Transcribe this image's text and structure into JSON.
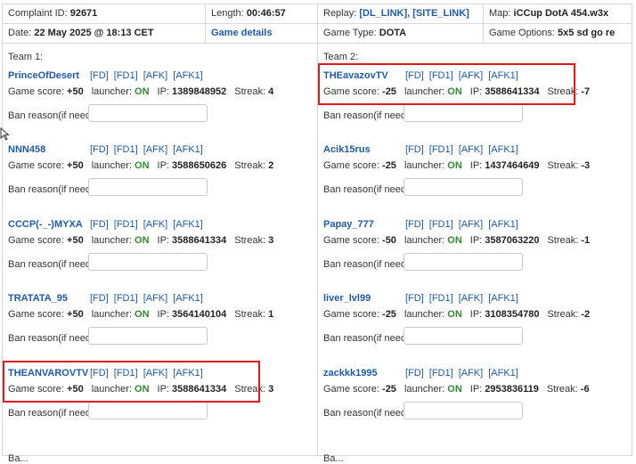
{
  "header": {
    "complaint_label": "Complaint ID: ",
    "complaint_id": "92671",
    "length_label": "Length: ",
    "length_value": "00:46:57",
    "replay_label": "Replay: ",
    "replay_links": "[DL_LINK], [SITE_LINK]",
    "map_label": "Map: ",
    "map_value": "iCCup DotA 454.w3x",
    "date_label": "Date: ",
    "date_value": "22 May 2025 @ 18:13 CET",
    "game_details": "Game details",
    "game_type_label": "Game Type: ",
    "game_type_value": "DOTA",
    "game_options_label": "Game Options: ",
    "game_options_value": "5x5 sd go re"
  },
  "labels": {
    "team1": "Team 1:",
    "team2": "Team 2:",
    "game_score": "Game score:",
    "launcher": "launcher:",
    "ip": "IP:",
    "streak": "Streak:",
    "ban_reason": "Ban reason(if need):",
    "flag_fd": "[FD]",
    "flag_fd1": "[FD1]",
    "flag_afk": "[AFK]",
    "flag_afk1": "[AFK1]",
    "footer": "Ba..."
  },
  "team1": [
    {
      "name": "PrinceOfDesert",
      "score": "+50",
      "launcher": "ON",
      "ip": "1389848952",
      "streak": "4"
    },
    {
      "name": "NNN458",
      "score": "+50",
      "launcher": "ON",
      "ip": "3588650626",
      "streak": "2"
    },
    {
      "name": "CCCP(-_-)MYXA",
      "score": "+50",
      "launcher": "ON",
      "ip": "3588641334",
      "streak": "3"
    },
    {
      "name": "TRATATA_95",
      "score": "+50",
      "launcher": "ON",
      "ip": "3564140104",
      "streak": "1"
    },
    {
      "name": "THEANVAROVTV",
      "score": "+50",
      "launcher": "ON",
      "ip": "3588641334",
      "streak": "3"
    }
  ],
  "team2": [
    {
      "name": "THEavazovTV",
      "score": "-25",
      "launcher": "ON",
      "ip": "3588641334",
      "streak": "-7"
    },
    {
      "name": "Acik15rus",
      "score": "-25",
      "launcher": "ON",
      "ip": "1437464649",
      "streak": "-3"
    },
    {
      "name": "Papay_777",
      "score": "-50",
      "launcher": "ON",
      "ip": "3587063220",
      "streak": "-1"
    },
    {
      "name": "liver_lvl99",
      "score": "-25",
      "launcher": "ON",
      "ip": "3108354780",
      "streak": "-2"
    },
    {
      "name": "zackkk1995",
      "score": "-25",
      "launcher": "ON",
      "ip": "2953836119",
      "streak": "-6"
    }
  ],
  "colors": {
    "link": "#1f5aa6",
    "launcher_on": "#2e8b2e",
    "highlight": "#e01a1a",
    "border": "#d6d6d6"
  }
}
